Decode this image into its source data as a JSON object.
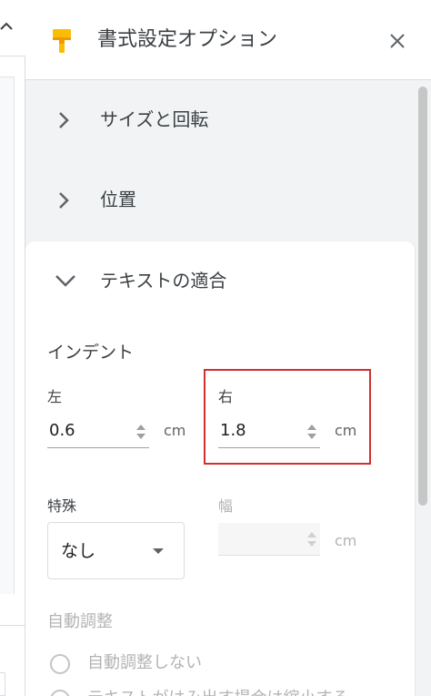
{
  "panel": {
    "title": "書式設定オプション",
    "close_icon": "close-icon",
    "title_icon": "paint-roller-icon",
    "accent_color": "#fbbc04"
  },
  "sections": [
    {
      "label": "サイズと回転",
      "expanded": false,
      "icon": "chevron-right-icon"
    },
    {
      "label": "位置",
      "expanded": false,
      "icon": "chevron-right-icon"
    }
  ],
  "text_fit": {
    "label": "テキストの適合",
    "expanded": true,
    "icon": "chevron-down-icon",
    "indent": {
      "title": "インデント",
      "left": {
        "label": "左",
        "value": "0.6",
        "unit": "cm"
      },
      "right": {
        "label": "右",
        "value": "1.8",
        "unit": "cm"
      },
      "special": {
        "label": "特殊",
        "value": "なし"
      },
      "width": {
        "label": "幅",
        "value": "",
        "unit": "cm",
        "disabled": true
      }
    },
    "autofit": {
      "title": "自動調整",
      "options": [
        {
          "label": "自動調整しない",
          "disabled": true
        },
        {
          "label": "テキストがはみ出す場合は縮小する",
          "disabled": true
        }
      ]
    }
  },
  "highlight_color": "#d32f2f"
}
